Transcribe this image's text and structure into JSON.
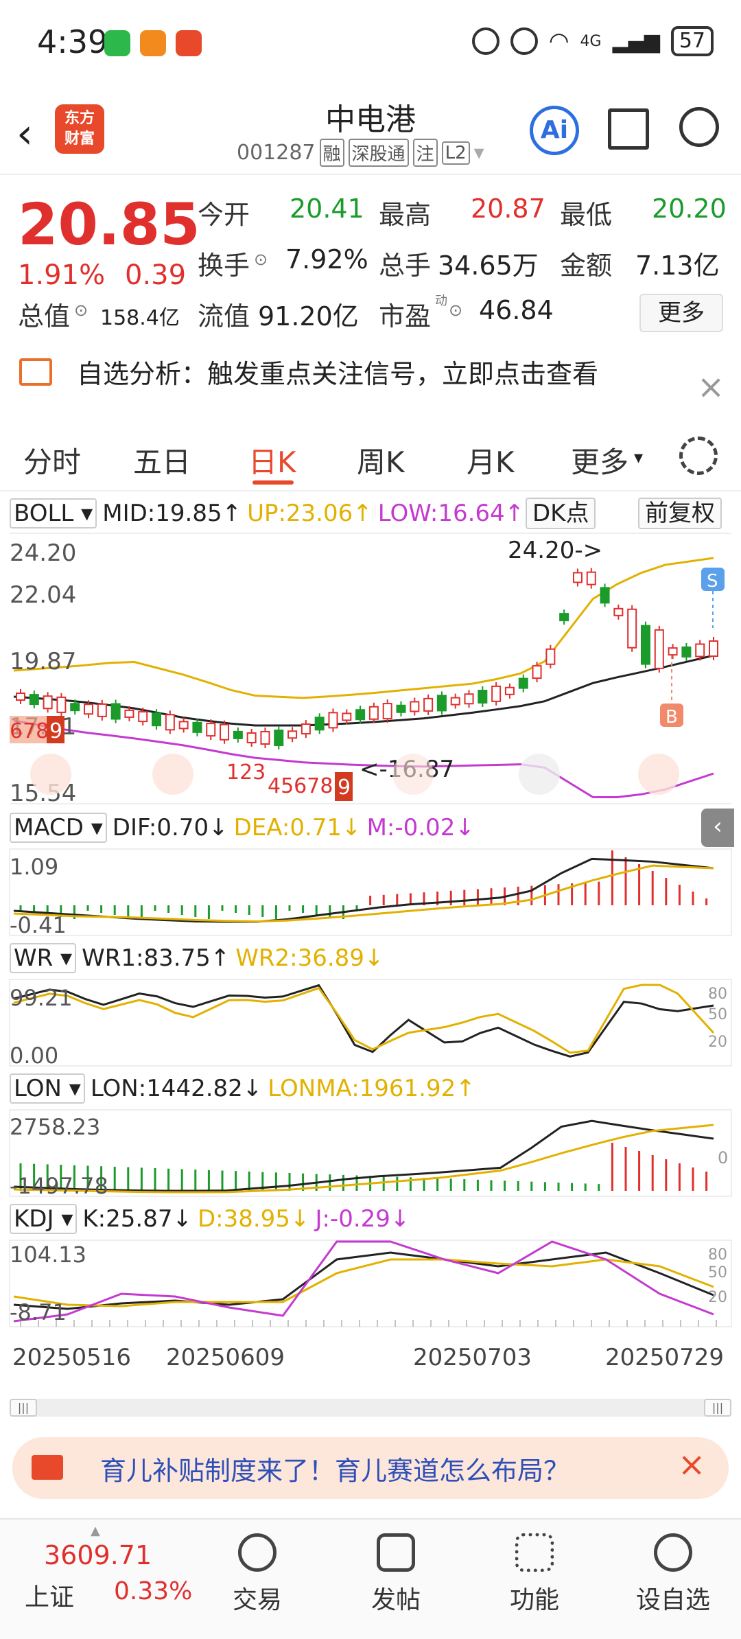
{
  "status": {
    "time": "4:39",
    "battery": "57",
    "network": "4G"
  },
  "header": {
    "logo_line1": "东方",
    "logo_line2": "财富",
    "name": "中电港",
    "code": "001287",
    "tags": [
      "融",
      "深股通",
      "注",
      "L2"
    ],
    "ai_label": "Ai"
  },
  "quote": {
    "price": "20.85",
    "change_pct": "1.91%",
    "change_abs": "0.39",
    "open_label": "今开",
    "open": "20.41",
    "high_label": "最高",
    "high": "20.87",
    "low_label": "最低",
    "low": "20.20",
    "turnover_label": "换手",
    "turnover": "7.92%",
    "volume_label": "总手",
    "volume": "34.65万",
    "amount_label": "金额",
    "amount": "7.13亿",
    "mktcap_label": "总值",
    "mktcap": "158.4亿",
    "float_label": "流值",
    "float": "91.20亿",
    "pe_label": "市盈",
    "pe_sup": "动",
    "pe": "46.84",
    "more": "更多"
  },
  "banner": {
    "text": "自选分析：触发重点关注信号，立即点击查看"
  },
  "tabs": [
    "分时",
    "五日",
    "日K",
    "周K",
    "月K",
    "更多"
  ],
  "boll": {
    "name": "BOLL",
    "mid": "MID:19.85↑",
    "up": "UP:23.06↑",
    "low": "LOW:16.64↑",
    "dk": "DK点",
    "adj": "前复权",
    "y_labels": [
      "24.20",
      "22.04",
      "19.87",
      "17.71",
      "15.54"
    ],
    "max_label": "24.20->",
    "min_label": "<-16.87",
    "seq1": "6789",
    "seq1_end": "9",
    "seq2": "123",
    "seq3": "45678",
    "seq3_end": "9",
    "sig_s": "S",
    "sig_b": "B"
  },
  "macd": {
    "name": "MACD",
    "dif": "DIF:0.70↓",
    "dea": "DEA:0.71↓",
    "m": "M:-0.02↓",
    "y_top": "1.09",
    "y_bot": "-0.41"
  },
  "wr": {
    "name": "WR",
    "wr1": "WR1:83.75↑",
    "wr2": "WR2:36.89↓",
    "y_top": "99.21",
    "y_bot": "0.00",
    "r80": "80",
    "r50": "50",
    "r20": "20"
  },
  "lon": {
    "name": "LON",
    "lon": "LON:1442.82↓",
    "lonma": "LONMA:1961.92↑",
    "y_top": "2758.23",
    "y_bot": "-1497.78",
    "r0": "0"
  },
  "kdj": {
    "name": "KDJ",
    "k": "K:25.87↓",
    "d": "D:38.95↓",
    "j": "J:-0.29↓",
    "y_top": "104.13",
    "y_bot": "-8.71",
    "r80": "80",
    "r50": "50",
    "r20": "20"
  },
  "dates": [
    "20250516",
    "20250609",
    "20250703",
    "20250729"
  ],
  "ad": {
    "text": "育儿补贴制度来了！育儿赛道怎么布局？"
  },
  "bottom": {
    "index_val": "3609.71",
    "index_name": "上证",
    "index_pct": "0.33%",
    "nav": [
      "交易",
      "发帖",
      "功能",
      "设自选"
    ]
  },
  "colors": {
    "up": "#e0302e",
    "down": "#1a9b2a",
    "accent": "#e8492b",
    "boll_up": "#e2b100",
    "boll_low": "#c43ad0"
  }
}
